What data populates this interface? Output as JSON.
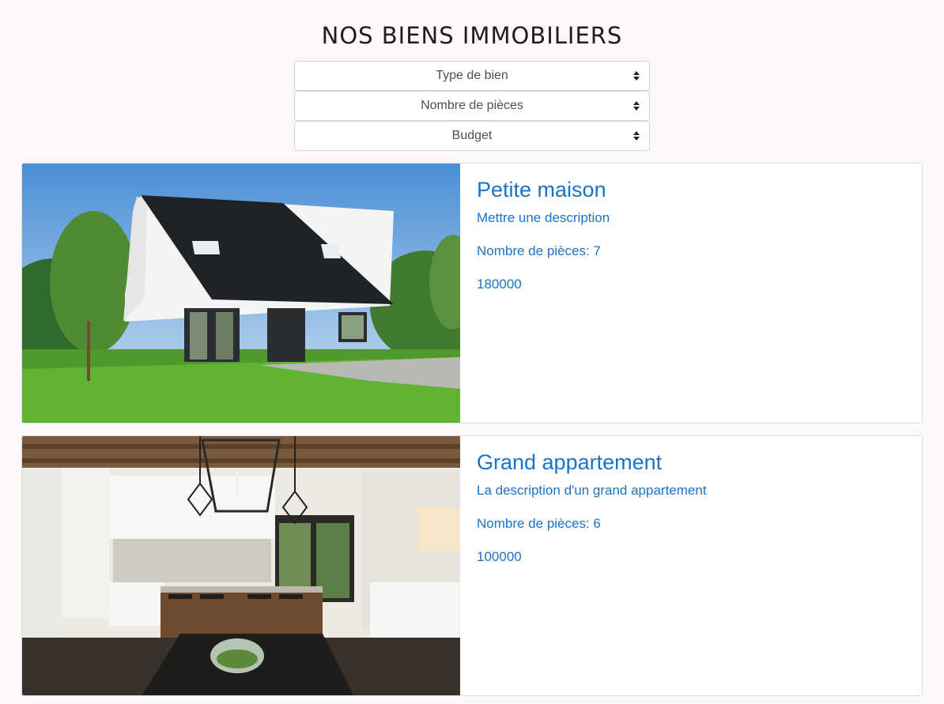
{
  "header": {
    "title": "NOS BIENS IMMOBILIERS"
  },
  "filters": [
    {
      "label": "Type de bien"
    },
    {
      "label": "Nombre de pièces"
    },
    {
      "label": "Budget"
    }
  ],
  "listings": [
    {
      "name": "Petite maison",
      "description": "Mettre une description",
      "rooms": "Nombre de pièces: 7",
      "price": "180000",
      "image": "house-photo"
    },
    {
      "name": "Grand appartement",
      "description": "La description d'un grand appartement",
      "rooms": "Nombre de pièces: 6",
      "price": "100000",
      "image": "kitchen-photo"
    }
  ],
  "colors": {
    "accent": "#1a73c9",
    "background": "#fdf8f7"
  }
}
